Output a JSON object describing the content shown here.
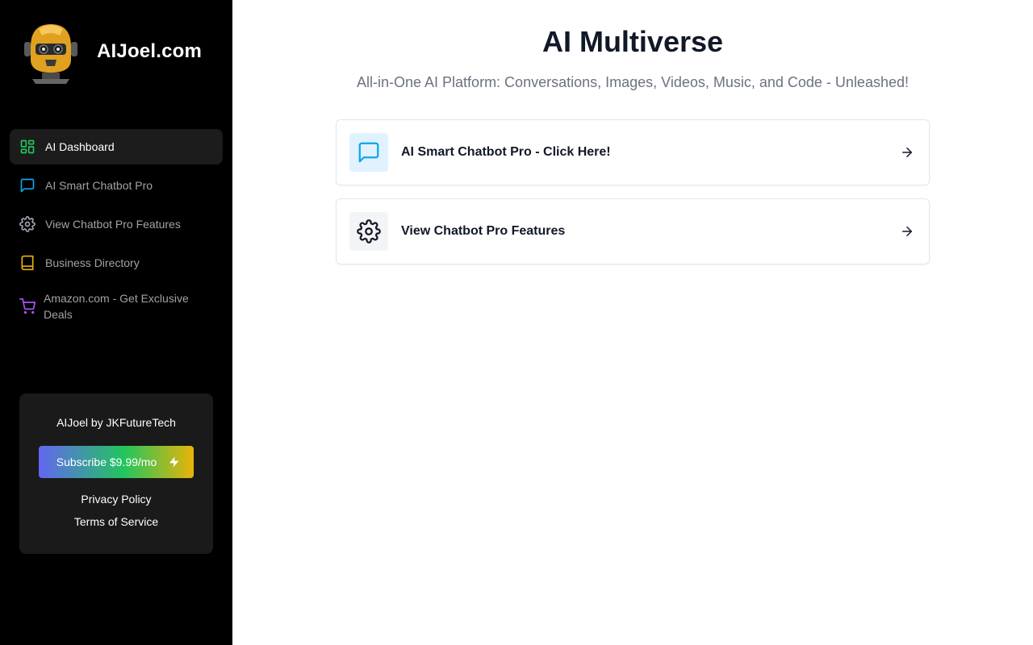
{
  "brand": {
    "name": "AIJoel.com"
  },
  "sidebar": {
    "items": [
      {
        "label": "AI Dashboard",
        "icon": "dashboard-icon",
        "color": "#22c55e",
        "active": true
      },
      {
        "label": "AI Smart Chatbot Pro",
        "icon": "chat-icon",
        "color": "#0ea5e9"
      },
      {
        "label": "View Chatbot Pro Features",
        "icon": "gear-icon",
        "color": "#9ca3af"
      },
      {
        "label": "Business Directory",
        "icon": "book-icon",
        "color": "#eab308"
      },
      {
        "label": "Amazon.com - Get Exclusive Deals",
        "icon": "cart-icon",
        "color": "#a855f7"
      }
    ]
  },
  "footer": {
    "title": "AIJoel by JKFutureTech",
    "subscribe_label": "Subscribe $9.99/mo",
    "privacy_label": "Privacy Policy",
    "terms_label": "Terms of Service"
  },
  "main": {
    "title": "AI Multiverse",
    "subtitle": "All-in-One AI Platform: Conversations, Images, Videos, Music, and Code - Unleashed!",
    "cards": [
      {
        "label": "AI Smart Chatbot Pro - Click Here!",
        "icon": "chat-icon",
        "color": "#0ea5e9"
      },
      {
        "label": "View Chatbot Pro Features",
        "icon": "gear-icon",
        "color": "#111827"
      }
    ]
  }
}
